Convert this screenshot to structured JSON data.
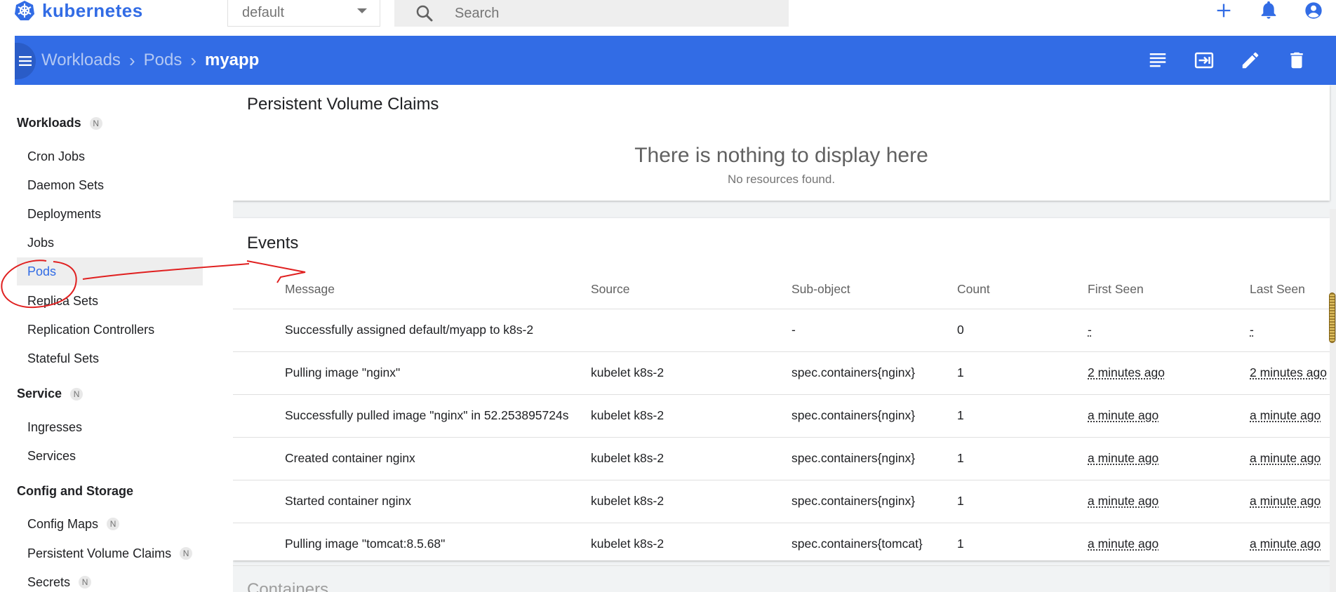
{
  "app": {
    "name": "kubernetes",
    "brand_color": "#326ce5"
  },
  "topbar": {
    "namespace": "default",
    "search_placeholder": "Search",
    "actions": [
      "add-icon",
      "bell-icon",
      "account-icon"
    ]
  },
  "toolbar": {
    "breadcrumb": [
      "Workloads",
      "Pods"
    ],
    "current": "myapp",
    "actions": [
      "logs-icon",
      "exec-icon",
      "edit-icon",
      "delete-icon"
    ]
  },
  "sidebar": {
    "sections": [
      {
        "label": "Workloads",
        "badge": "N",
        "items": [
          "Cron Jobs",
          "Daemon Sets",
          "Deployments",
          "Jobs",
          "Pods",
          "Replica Sets",
          "Replication Controllers",
          "Stateful Sets"
        ]
      },
      {
        "label": "Service",
        "badge": "N",
        "items": [
          "Ingresses",
          "Services"
        ]
      },
      {
        "label": "Config and Storage",
        "items": [
          {
            "label": "Config Maps",
            "badge": "N"
          },
          {
            "label": "Persistent Volume Claims",
            "badge": "N"
          },
          {
            "label": "Secrets",
            "badge": "N"
          }
        ]
      }
    ],
    "active_item": "Pods"
  },
  "pvc_card": {
    "title": "Persistent Volume Claims",
    "empty_title": "There is nothing to display here",
    "empty_sub": "No resources found."
  },
  "events_card": {
    "title": "Events",
    "columns": [
      "Message",
      "Source",
      "Sub-object",
      "Count",
      "First Seen",
      "Last Seen"
    ],
    "rows": [
      {
        "message": "Successfully assigned default/myapp to k8s-2",
        "source": "",
        "subobject": "-",
        "count": "0",
        "first_seen": "-",
        "last_seen": "-"
      },
      {
        "message": "Pulling image \"nginx\"",
        "source": "kubelet k8s-2",
        "subobject": "spec.containers{nginx}",
        "count": "1",
        "first_seen": "2 minutes ago",
        "last_seen": "2 minutes ago"
      },
      {
        "message": "Successfully pulled image \"nginx\" in 52.253895724s",
        "source": "kubelet k8s-2",
        "subobject": "spec.containers{nginx}",
        "count": "1",
        "first_seen": "a minute ago",
        "last_seen": "a minute ago"
      },
      {
        "message": "Created container nginx",
        "source": "kubelet k8s-2",
        "subobject": "spec.containers{nginx}",
        "count": "1",
        "first_seen": "a minute ago",
        "last_seen": "a minute ago"
      },
      {
        "message": "Started container nginx",
        "source": "kubelet k8s-2",
        "subobject": "spec.containers{nginx}",
        "count": "1",
        "first_seen": "a minute ago",
        "last_seen": "a minute ago"
      },
      {
        "message": "Pulling image \"tomcat:8.5.68\"",
        "source": "kubelet k8s-2",
        "subobject": "spec.containers{tomcat}",
        "count": "1",
        "first_seen": "a minute ago",
        "last_seen": "a minute ago"
      }
    ]
  },
  "next_section": {
    "title": "Containers"
  },
  "annotation_color": "#e02020"
}
